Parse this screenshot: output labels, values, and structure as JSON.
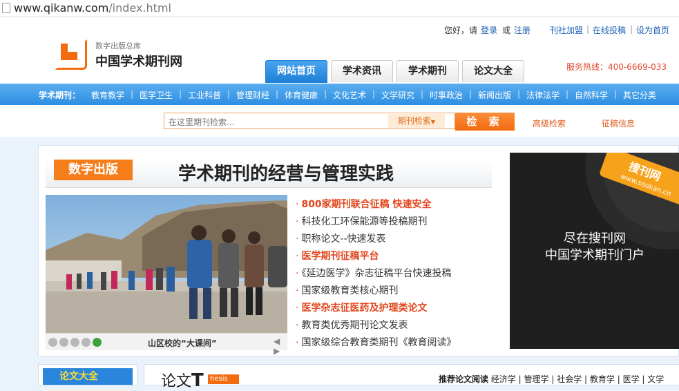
{
  "browser": {
    "url_host": "www.qikanw.com",
    "url_path": "/index.html"
  },
  "header": {
    "logo_sub": "数字出版总库",
    "logo_title": "中国学术期刊网",
    "greeting": "您好，请",
    "login": "登录",
    "or": "或",
    "register": "注册",
    "links": [
      "刊社加盟",
      "在线投稿",
      "设为首页"
    ],
    "hotline": "服务热线：400-6669-033"
  },
  "tabs": [
    {
      "label": "网站首页",
      "active": true
    },
    {
      "label": "学术资讯",
      "active": false
    },
    {
      "label": "学术期刊",
      "active": false
    },
    {
      "label": "论文大全",
      "active": false
    }
  ],
  "categories": {
    "lead": "学术期刊：",
    "items": [
      "教育教学",
      "医学卫生",
      "工业科普",
      "管理财经",
      "体育健康",
      "文化艺术",
      "文学研究",
      "时事政治",
      "新闻出版",
      "法律法学",
      "自然科学",
      "其它分类"
    ]
  },
  "search": {
    "placeholder": "在这里期刊检索...",
    "select": "期刊检索",
    "button": "检 索",
    "advanced": "高级检索",
    "calls": "征稿信息"
  },
  "section": {
    "badge": "数字出版",
    "title": "学术期刊的经营与管理实践"
  },
  "photo": {
    "caption": "山区校的“大课间”"
  },
  "news": [
    {
      "text": "800家期刊联合征稿 快速安全",
      "highlight": true
    },
    {
      "text": "科技化工环保能源等投稿期刊",
      "highlight": false
    },
    {
      "text": "职称论文--快速发表",
      "highlight": false
    },
    {
      "text": "医学期刊征稿平台",
      "highlight": true
    },
    {
      "text": "《延边医学》杂志征稿平台快速投稿",
      "highlight": false
    },
    {
      "text": "国家级教育类核心期刊",
      "highlight": false
    },
    {
      "text": "医学杂志征医药及护理类论文",
      "highlight": true
    },
    {
      "text": "教育类优秀期刊论文发表",
      "highlight": false
    },
    {
      "text": "国家级综合教育类期刊《教育阅读》",
      "highlight": false
    }
  ],
  "ad": {
    "logo": "搜刊网",
    "logo_url": "www.sookan.cn",
    "line1": "尽在搜刊网",
    "line2": "中国学术期刊门户"
  },
  "bottom": {
    "left_title": "论文大全",
    "lunwen": "论文",
    "thesis": "hesis",
    "recommend_label": "推荐论文阅读",
    "recommend_items": [
      "经济学",
      "管理学",
      "社会学",
      "教育学",
      "医学",
      "文学"
    ]
  },
  "colors": {
    "accent": "#f26b10",
    "nav_blue": "#2e8ee2",
    "link_blue": "#1a5fb4",
    "highlight_red": "#e2461c"
  }
}
